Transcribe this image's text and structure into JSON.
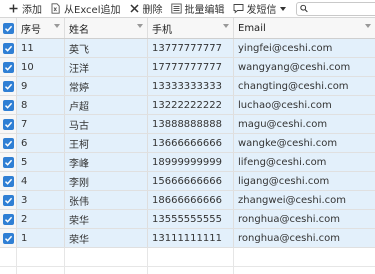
{
  "toolbar": {
    "add_label": "添加",
    "excel_add_label": "从Excel追加",
    "delete_label": "删除",
    "batch_edit_label": "批量编辑",
    "send_sms_label": "发短信",
    "search_placeholder": ""
  },
  "table": {
    "columns": [
      "序号",
      "姓名",
      "手机",
      "Email"
    ],
    "rows": [
      {
        "id": "11",
        "name": "英飞",
        "phone": "13777777777",
        "email": "yingfei@ceshi.com"
      },
      {
        "id": "10",
        "name": "汪洋",
        "phone": "17777777777",
        "email": "wangyang@ceshi.com"
      },
      {
        "id": "9",
        "name": "常婷",
        "phone": "13333333333",
        "email": "changting@ceshi.com"
      },
      {
        "id": "8",
        "name": "卢超",
        "phone": "13222222222",
        "email": "luchao@ceshi.com"
      },
      {
        "id": "7",
        "name": "马古",
        "phone": "13888888888",
        "email": "magu@ceshi.com"
      },
      {
        "id": "6",
        "name": "王柯",
        "phone": "13666666666",
        "email": "wangke@ceshi.com"
      },
      {
        "id": "5",
        "name": "李峰",
        "phone": "18999999999",
        "email": "lifeng@ceshi.com"
      },
      {
        "id": "4",
        "name": "李刚",
        "phone": "15666666666",
        "email": "ligang@ceshi.com"
      },
      {
        "id": "3",
        "name": "张伟",
        "phone": "18666666666",
        "email": "zhangwei@ceshi.com"
      },
      {
        "id": "2",
        "name": "荣华",
        "phone": "13555555555",
        "email": "ronghua@ceshi.com"
      },
      {
        "id": "1",
        "name": "荣华",
        "phone": "13111111111",
        "email": "ronghua@ceshi.com"
      }
    ]
  },
  "colors": {
    "selected_row": "#e3f0fb",
    "checkbox": "#2f7fd4"
  }
}
